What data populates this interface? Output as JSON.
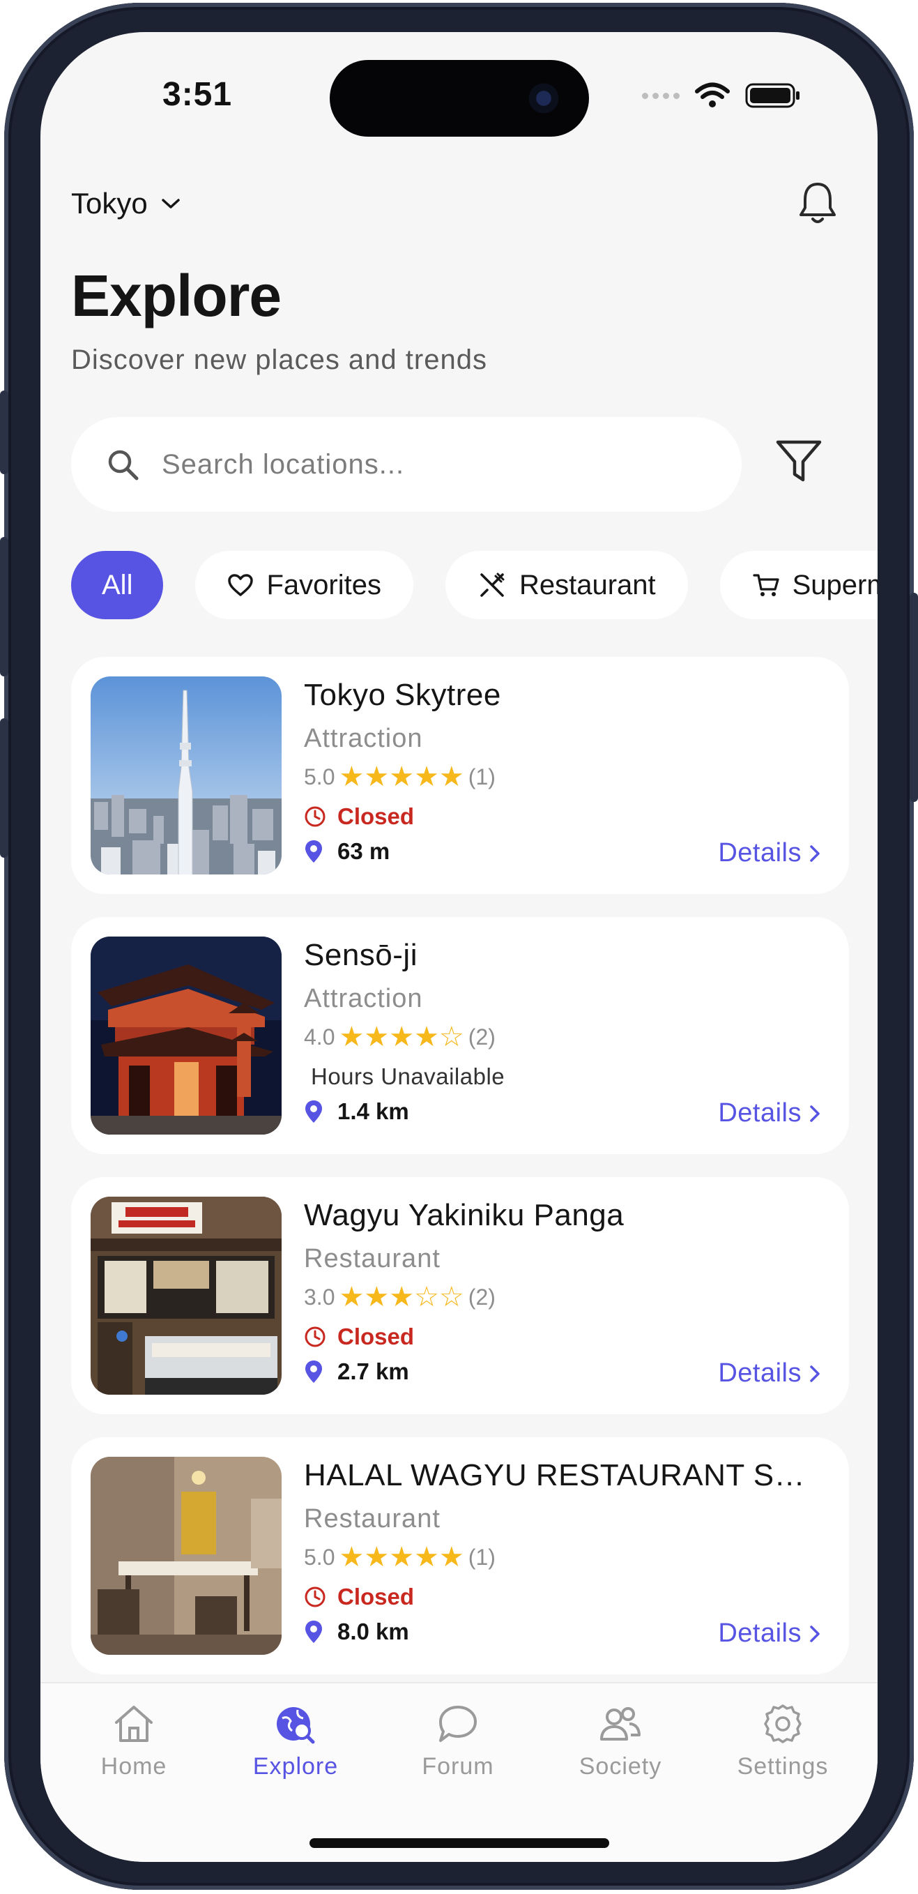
{
  "status_bar": {
    "time": "3:51"
  },
  "header": {
    "city": "Tokyo",
    "title": "Explore",
    "subtitle": "Discover new places and trends"
  },
  "search": {
    "placeholder": "Search locations..."
  },
  "chips": [
    {
      "label": "All",
      "icon": "none",
      "active": true
    },
    {
      "label": "Favorites",
      "icon": "heart-icon"
    },
    {
      "label": "Restaurant",
      "icon": "utensils-icon"
    },
    {
      "label": "Superma",
      "icon": "cart-icon"
    }
  ],
  "places": [
    {
      "name": "Tokyo Skytree",
      "category": "Attraction",
      "rating": "5.0",
      "stars": 5,
      "reviews": "(1)",
      "status": "Closed",
      "status_type": "closed",
      "distance": "63 m",
      "details_label": "Details"
    },
    {
      "name": "Sensō-ji",
      "category": "Attraction",
      "rating": "4.0",
      "stars": 4,
      "reviews": "(2)",
      "status": "Hours Unavailable",
      "status_type": "plain",
      "distance": "1.4 km",
      "details_label": "Details"
    },
    {
      "name": "Wagyu Yakiniku Panga",
      "category": "Restaurant",
      "rating": "3.0",
      "stars": 3,
      "reviews": "(2)",
      "status": "Closed",
      "status_type": "closed",
      "distance": "2.7 km",
      "details_label": "Details"
    },
    {
      "name": "HALAL WAGYU RESTAURANT SHI...",
      "category": "Restaurant",
      "rating": "5.0",
      "stars": 5,
      "reviews": "(1)",
      "status": "Closed",
      "status_type": "closed",
      "distance": "8.0 km",
      "details_label": "Details"
    }
  ],
  "tabs": [
    {
      "label": "Home",
      "icon": "house-icon",
      "active": false
    },
    {
      "label": "Explore",
      "icon": "explore-globe-icon",
      "active": true
    },
    {
      "label": "Forum",
      "icon": "chat-bubble-icon",
      "active": false
    },
    {
      "label": "Society",
      "icon": "people-icon",
      "active": false
    },
    {
      "label": "Settings",
      "icon": "gear-icon",
      "active": false
    }
  ],
  "colors": {
    "accent": "#5753e3",
    "star": "#f6b81b",
    "closed": "#c8281f",
    "background": "#f6f6f6"
  }
}
